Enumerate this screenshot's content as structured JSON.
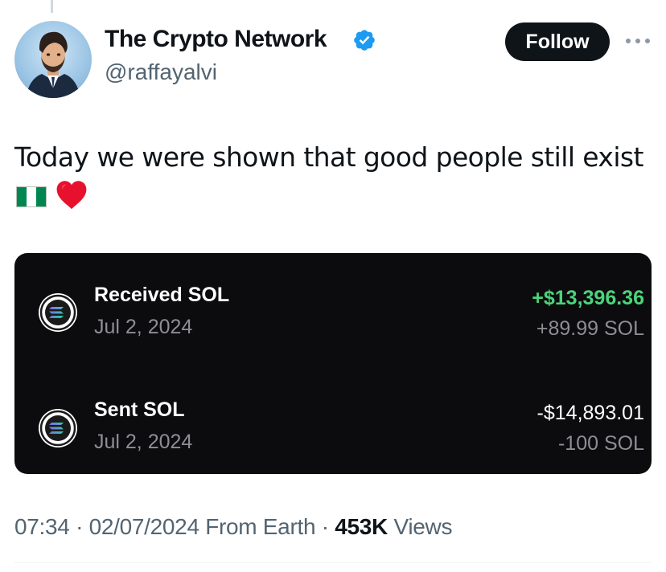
{
  "author": {
    "display_name": "The Crypto Network",
    "handle": "@raffayalvi",
    "verified_icon": "verified-badge-icon",
    "verified_color": "#1d9bf0"
  },
  "actions": {
    "follow_label": "Follow",
    "more_icon": "more-horizontal-icon"
  },
  "tweet": {
    "text": "Today we were shown that good people still exist",
    "emojis": [
      "nigeria-flag-icon",
      "red-heart-icon"
    ]
  },
  "card": {
    "background": "#0c0c0e",
    "transactions": [
      {
        "title": "Received SOL",
        "date": "Jul 2, 2024",
        "amount_usd": "+$13,396.36",
        "amount_sol": "+89.99 SOL",
        "icon": "solana-icon",
        "amount_color": "#4cd47a"
      },
      {
        "title": "Sent SOL",
        "date": "Jul 2, 2024",
        "amount_usd": "-$14,893.01",
        "amount_sol": "-100 SOL",
        "icon": "solana-icon",
        "amount_color": "#ffffff"
      }
    ]
  },
  "meta": {
    "time": "07:34",
    "separator": "·",
    "date": "02/07/2024",
    "source": "From Earth",
    "views_count": "453K",
    "views_label": "Views"
  }
}
